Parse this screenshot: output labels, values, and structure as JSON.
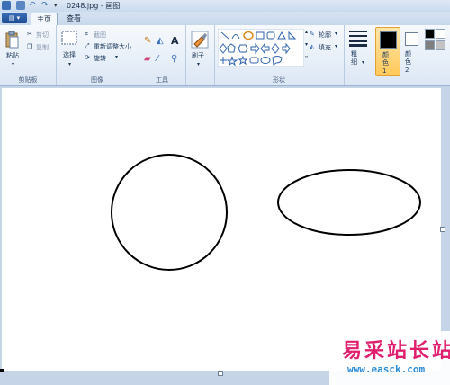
{
  "window": {
    "title": "0248.jpg - 画图"
  },
  "tabs": [
    {
      "label": "主页"
    },
    {
      "label": "查看"
    }
  ],
  "clipboard": {
    "paste": "粘贴",
    "cut": "剪切",
    "copy": "复制",
    "group": "剪贴板"
  },
  "image": {
    "select": "选择",
    "crop": "截图",
    "resize": "重新调整大小",
    "rotate": "旋转",
    "group": "图像"
  },
  "tools": {
    "group": "工具",
    "text_tool": "A"
  },
  "brushes": {
    "label": "刷子"
  },
  "shapes": {
    "outline": "轮廓",
    "fill": "填充",
    "group": "形状"
  },
  "size": {
    "label": "粗细"
  },
  "colors": {
    "color1": "颜色 1",
    "color2": "颜色 2",
    "color1_value": "#000000",
    "color2_value": "#ffffff",
    "palette": [
      "#000000",
      "#ffffff",
      "#7f7f7f",
      "#c3c3c3"
    ]
  },
  "watermark": {
    "cn": "易采站长站",
    "url": "www.easck.com"
  }
}
